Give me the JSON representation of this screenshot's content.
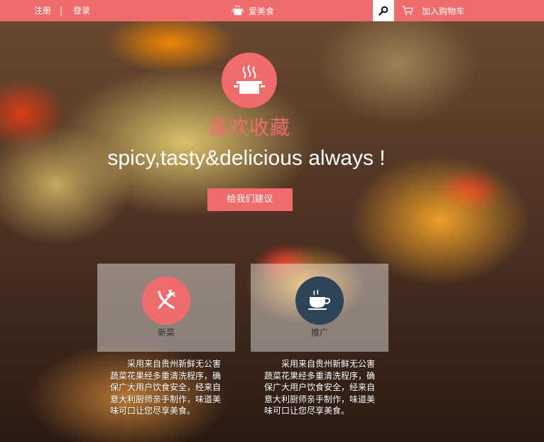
{
  "header": {
    "register": "注册",
    "separator": "|",
    "login": "登录",
    "brand": "爱美食",
    "search_icon": "magnifier-icon",
    "cart_icon": "cart-icon",
    "cart_label": "加入购物车"
  },
  "hero": {
    "icon": "cooking-pot-icon",
    "title": "喜欢收藏",
    "subtitle": "spicy,tasty&delicious always !",
    "cta_label": "给我们建议"
  },
  "cards": [
    {
      "icon": "fork-knife-icon",
      "label": "新菜",
      "description": "采用来自贵州新鲜无公害蔬菜花果经多重清洗程序，确保广大用户饮食安全，经来自意大利厨师亲手制作，味道美味可口让您尽享美食。"
    },
    {
      "icon": "coffee-cup-icon",
      "label": "推广",
      "description": "采用来自贵州新鲜无公害蔬菜花果经多重清洗程序，确保广大用户饮食安全，经来自意大利厨师亲手制作，味道美味可口让您尽享美食。"
    }
  ],
  "colors": {
    "accent": "#f06b6b",
    "dark_circle": "#2e4457"
  }
}
